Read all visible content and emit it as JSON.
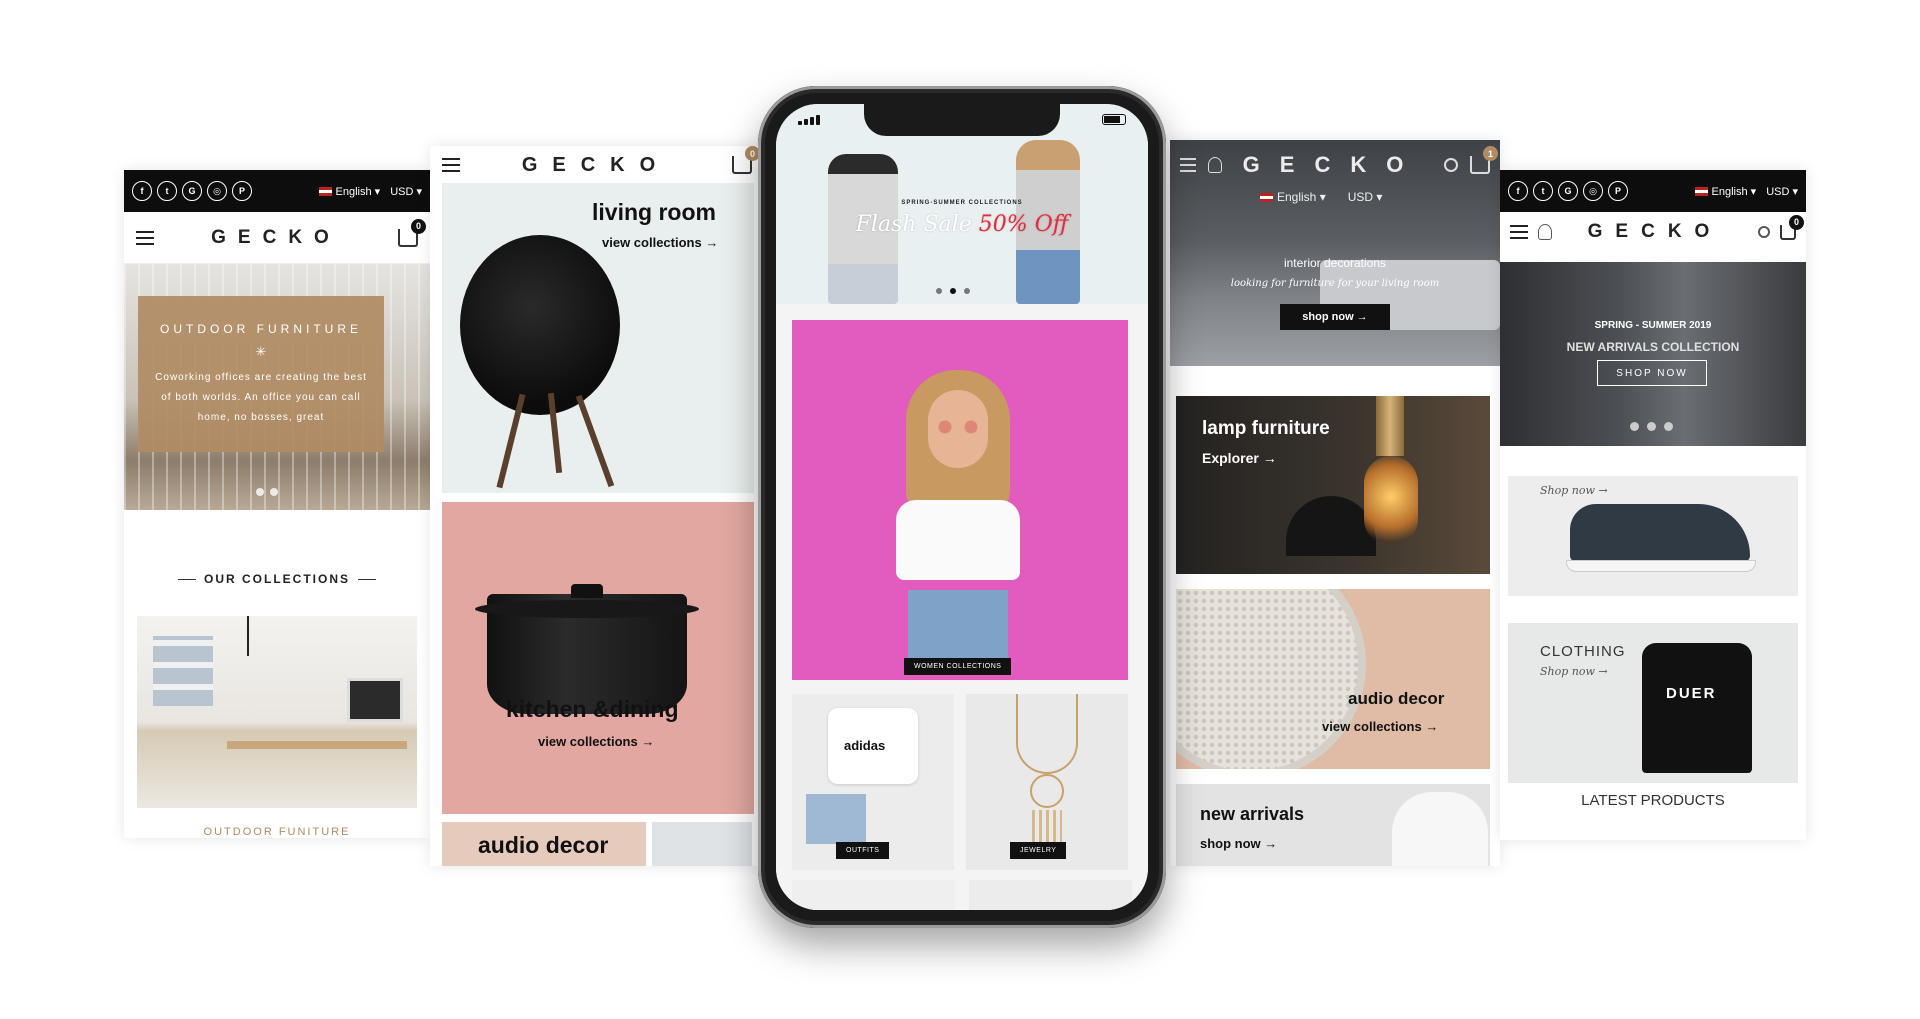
{
  "screen1": {
    "lang": "English",
    "currency": "USD",
    "logo": "GECKO",
    "cart_count": "0",
    "hero_title": "OUTDOOR FURNITURE",
    "hero_star": "✳",
    "hero_text": "Coworking offices are creating the best of both worlds. An office you can call home, no bosses, great",
    "collections_title": "OUR COLLECTIONS",
    "under_label": "OUTDOOR FUNITURE"
  },
  "screen2": {
    "logo": "GECKO",
    "cart_count": "0",
    "living_title": "living room",
    "living_link": "view collections →",
    "kitchen_title": "kitchen &dining",
    "kitchen_link": "view collections →",
    "audio_title": "audio decor"
  },
  "phone": {
    "hero_caption": "SPRING-SUMMER COLLECTIONS",
    "hero_sale": "Flash Sale",
    "hero_discount": "50% Off",
    "women_tag": "WOMEN COLLECTIONS",
    "outfits_tag": "OUTFITS",
    "tee_brand": "adidas",
    "jewelry_tag": "JEWELRY"
  },
  "screen4": {
    "logo": "GECKO",
    "cart_count": "1",
    "lang": "English",
    "currency": "USD",
    "hero_title": "interior decorations",
    "hero_sub": "looking for furniture for your living room",
    "hero_button": "shop now →",
    "lamp_title": "lamp furniture",
    "lamp_link": "Explorer →",
    "audio_title": "audio decor",
    "audio_link": "view collections →",
    "new_title": "new arrivals",
    "new_link": "shop now →"
  },
  "screen5": {
    "lang": "English",
    "currency": "USD",
    "logo": "GECKO",
    "cart_count": "0",
    "hero_season": "SPRING - SUMMER 2019",
    "hero_title": "NEW ARRIVALS COLLECTION",
    "hero_button": "SHOP NOW",
    "shop_now_1": "Shop now →",
    "clothing_title": "CLOTHING",
    "shop_now_2": "Shop now →",
    "tee_print": "DUER",
    "latest_title": "LATEST PRODUCTS"
  },
  "colors": {
    "accent_brown": "#b08b63",
    "pink_bg": "#e25cc0",
    "kitchen_bg": "#e2a7a0",
    "sale_red": "#e82a3a"
  }
}
